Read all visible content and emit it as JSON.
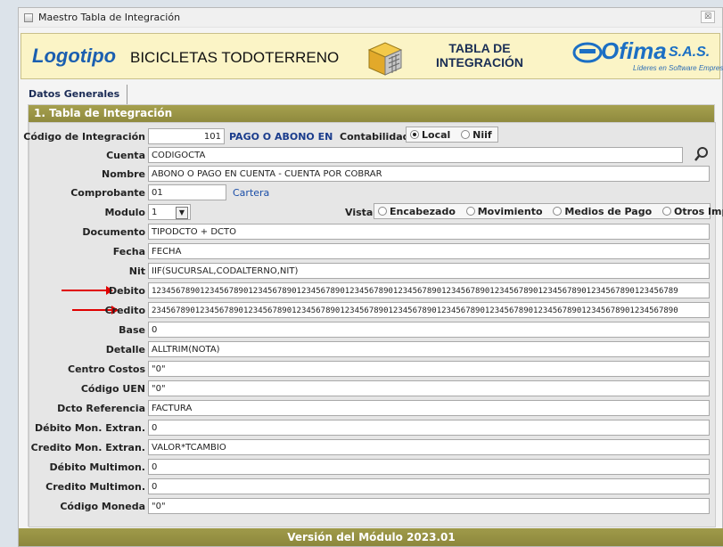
{
  "window": {
    "title": "Maestro Tabla de Integración",
    "close_label": "☒"
  },
  "banner": {
    "logo_text": "Logotipo",
    "company": "BICICLETAS TODOTERRENO",
    "module_title_line1": "TABLA DE",
    "module_title_line2": "INTEGRACIÓN",
    "brand_name": "Ofima",
    "brand_suffix": "S.A.S.",
    "brand_tagline": "Líderes en Software Empresarial"
  },
  "tabs": [
    {
      "label": "Datos Generales"
    }
  ],
  "section": {
    "title": "1. Tabla de Integración"
  },
  "form": {
    "codigo": {
      "label": "Código de Integración",
      "value": "101",
      "desc": "PAGO O ABONO EN"
    },
    "contabilidad": {
      "label": "Contabilidad",
      "options": [
        "Local",
        "Niif"
      ],
      "selected": "Local"
    },
    "cuenta": {
      "label": "Cuenta",
      "value": "CODIGOCTA"
    },
    "nombre": {
      "label": "Nombre",
      "value": "ABONO O PAGO EN CUENTA - CUENTA POR COBRAR"
    },
    "comprobante": {
      "label": "Comprobante",
      "value": "01",
      "desc": "Cartera"
    },
    "modulo": {
      "label": "Modulo",
      "value": "1"
    },
    "vista": {
      "label": "Vista",
      "options": [
        "Encabezado",
        "Movimiento",
        "Medios de Pago",
        "Otros Imp"
      ],
      "selected": ""
    },
    "documento": {
      "label": "Documento",
      "value": "TIPODCTO + DCTO"
    },
    "fecha": {
      "label": "Fecha",
      "value": "FECHA"
    },
    "nit": {
      "label": "Nit",
      "value": "IIF(SUCURSAL,CODALTERNO,NIT)"
    },
    "debito": {
      "label": "Debito",
      "value": "1234567890123456789012345678901234567890123456789012345678901234567890123456789012345678901234567890123456789"
    },
    "credito": {
      "label": "Credito",
      "value": "2345678901234567890123456789012345678901234567890123456789012345678901234567890123456789012345678901234567890"
    },
    "base": {
      "label": "Base",
      "value": "0"
    },
    "detalle": {
      "label": "Detalle",
      "value": "ALLTRIM(NOTA)"
    },
    "centro_costos": {
      "label": "Centro Costos",
      "value": "\"0\""
    },
    "codigo_uen": {
      "label": "Código UEN",
      "value": "\"0\""
    },
    "dcto_referencia": {
      "label": "Dcto Referencia",
      "value": "FACTURA"
    },
    "debito_mon_extran": {
      "label": "Débito Mon. Extran.",
      "value": "0"
    },
    "credito_mon_extran": {
      "label": "Credito Mon. Extran.",
      "value": "VALOR*TCAMBIO"
    },
    "debito_multimon": {
      "label": "Débito Multimon.",
      "value": "0"
    },
    "credito_multimon": {
      "label": "Credito Multimon.",
      "value": "0"
    },
    "codigo_moneda": {
      "label": "Código Moneda",
      "value": "\"0\""
    }
  },
  "footer": {
    "version": "Versión del Módulo 2023.01"
  },
  "colors": {
    "accent": "#9a9548",
    "brand": "#1b6fc4",
    "annotation_arrow": "#e00000"
  }
}
